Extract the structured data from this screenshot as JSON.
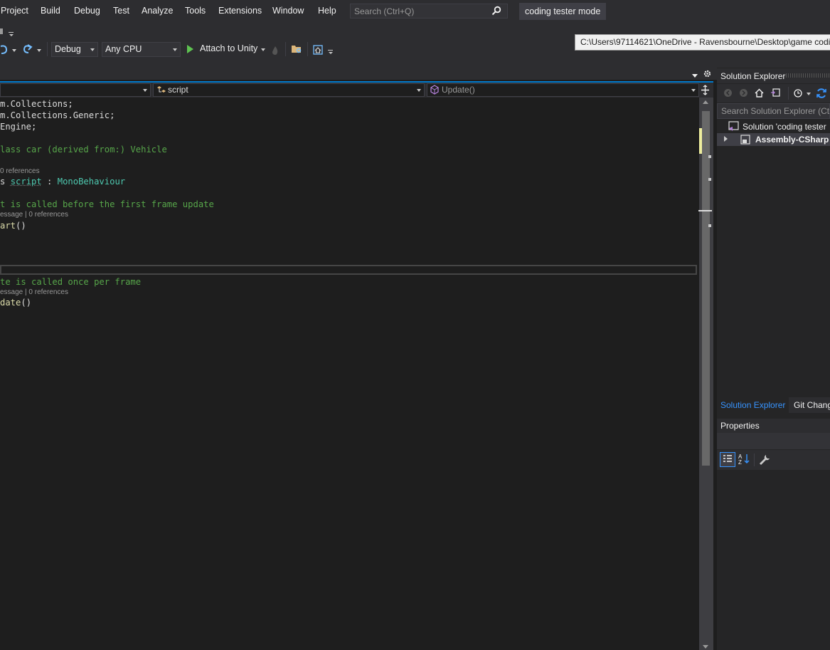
{
  "menu": [
    "Project",
    "Build",
    "Debug",
    "Test",
    "Analyze",
    "Tools",
    "Extensions",
    "Window",
    "Help"
  ],
  "search": {
    "placeholder": "Search (Ctrl+Q)"
  },
  "mode_badge": "coding tester mode",
  "toolbar": {
    "config": "Debug",
    "platform": "Any CPU",
    "attach": "Attach to Unity"
  },
  "tooltip": "C:\\Users\\97114621\\OneDrive - Ravensbourne\\Desktop\\game codin",
  "nav": {
    "class_combo": "script",
    "member_combo": "Update()"
  },
  "code": {
    "l1": "m.Collections;",
    "l2": "m.Collections.Generic;",
    "l3": "Engine;",
    "l4": "lass car (derived from:) Vehicle",
    "lens1": "0 references",
    "l5a": "s ",
    "l5b": "script",
    "l5c": " : ",
    "l5d": "MonoBehaviour",
    "l6": "t is called before the first frame update",
    "lens2": "essage | 0 references",
    "l7a": "art",
    "l7b": "()",
    "l8": "te is called once per frame",
    "lens3": "essage | 0 references",
    "l9a": "date",
    "l9b": "()"
  },
  "solution_explorer": {
    "title": "Solution Explorer",
    "search": "Search Solution Explorer (Ctrl",
    "solution": "Solution 'coding tester",
    "project": "Assembly-CSharp",
    "tab1": "Solution Explorer",
    "tab2": "Git Chang"
  },
  "properties": {
    "title": "Properties"
  },
  "colors": {
    "accent": "#007acc",
    "comment": "#57a64a",
    "type": "#4ec9b0"
  }
}
